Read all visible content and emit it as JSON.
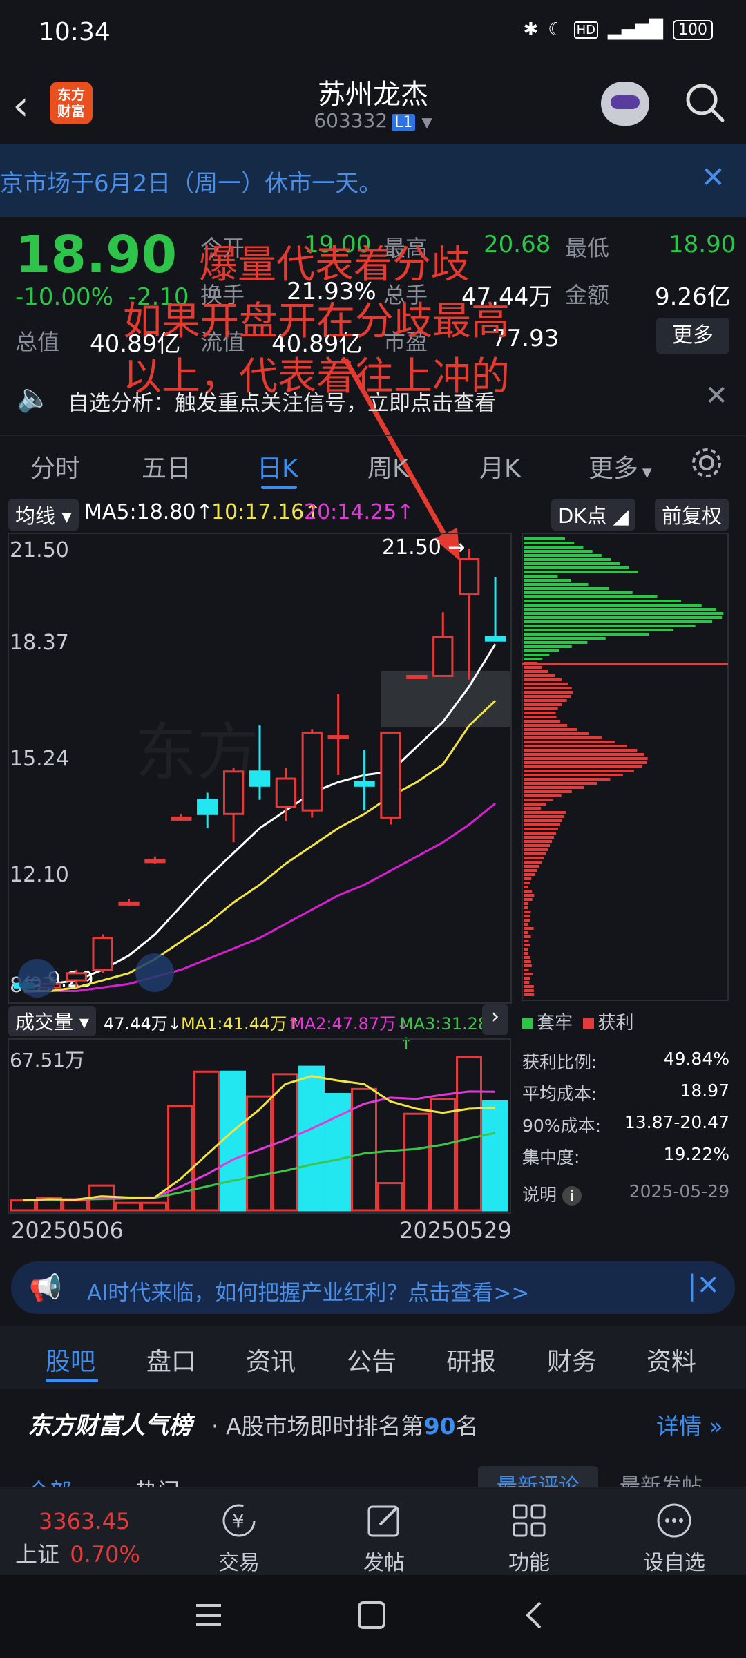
{
  "status": {
    "time": "10:34",
    "icons": [
      "bluetooth-icon",
      "moon-icon",
      "hd-icon",
      "signal-4g-icon"
    ],
    "battery": "100"
  },
  "header": {
    "logo_line1": "东方",
    "logo_line2": "财富",
    "name": "苏州龙杰",
    "code": "603332",
    "level": "L1"
  },
  "notice": {
    "text": "京市场于6月2日（周一）休市一天。"
  },
  "quote": {
    "price": "18.90",
    "change_pct": "-10.00%",
    "change_abs": "-2.10",
    "open_label": "今开",
    "open": "19.00",
    "high_label": "最高",
    "high": "20.68",
    "low_label": "最低",
    "low": "18.90",
    "turnover_label": "换手",
    "turnover": "21.93%",
    "volume_label": "总手",
    "volume": "47.44万",
    "amount_label": "金额",
    "amount": "9.26亿",
    "mktcap_label": "总值",
    "mktcap": "40.89亿",
    "float_label": "流值",
    "float": "40.89亿",
    "pe_label": "市盈",
    "pe": "77.93",
    "more_label": "更多"
  },
  "alert": {
    "text": "自选分析：触发重点关注信号，立即点击查看"
  },
  "tabs": [
    "分时",
    "五日",
    "日K",
    "周K",
    "月K",
    "更多"
  ],
  "ma_bar": {
    "type_label": "均线",
    "ma5": "MA5:18.80",
    "ma10": "10:17.16",
    "ma20": "20:14.25",
    "dk_label": "DK点",
    "adjust_label": "前复权"
  },
  "annotation": {
    "line1": "爆量代表着分歧",
    "line2": "如果开盘开在分歧最高",
    "line3": "以上，代表着往上冲的"
  },
  "chart_data": [
    {
      "type": "candlestick",
      "title": "日K",
      "y_ticks": [
        "21.50",
        "18.37",
        "15.24",
        "12.10",
        "8.97"
      ],
      "ylim": [
        8.97,
        21.5
      ],
      "high_marker": "21.50",
      "low_marker": "9.29",
      "candles": [
        {
          "o": 9.2,
          "h": 9.3,
          "l": 9.0,
          "c": 9.1
        },
        {
          "o": 9.1,
          "h": 9.3,
          "l": 9.0,
          "c": 9.2
        },
        {
          "o": 9.3,
          "h": 9.6,
          "l": 9.1,
          "c": 9.5
        },
        {
          "o": 9.6,
          "h": 10.6,
          "l": 9.5,
          "c": 10.5
        },
        {
          "o": 11.5,
          "h": 11.6,
          "l": 11.4,
          "c": 11.5
        },
        {
          "o": 12.7,
          "h": 12.8,
          "l": 12.6,
          "c": 12.7
        },
        {
          "o": 13.9,
          "h": 14.0,
          "l": 13.8,
          "c": 13.9
        },
        {
          "o": 14.4,
          "h": 14.6,
          "l": 13.6,
          "c": 14.0
        },
        {
          "o": 14.0,
          "h": 15.3,
          "l": 13.2,
          "c": 15.2
        },
        {
          "o": 15.2,
          "h": 16.5,
          "l": 14.4,
          "c": 14.8
        },
        {
          "o": 14.2,
          "h": 15.3,
          "l": 13.8,
          "c": 15.0
        },
        {
          "o": 14.1,
          "h": 16.4,
          "l": 13.9,
          "c": 16.3
        },
        {
          "o": 16.2,
          "h": 17.4,
          "l": 15.1,
          "c": 16.2
        },
        {
          "o": 14.9,
          "h": 15.8,
          "l": 14.1,
          "c": 14.8
        },
        {
          "o": 13.9,
          "h": 16.3,
          "l": 13.7,
          "c": 16.3
        },
        {
          "o": 17.9,
          "h": 17.9,
          "l": 17.9,
          "c": 17.9
        },
        {
          "o": 17.9,
          "h": 19.7,
          "l": 17.9,
          "c": 19.0
        },
        {
          "o": 20.2,
          "h": 21.5,
          "l": 17.8,
          "c": 21.2
        },
        {
          "o": 19.0,
          "h": 20.7,
          "l": 18.9,
          "c": 18.9
        }
      ],
      "ma5": [
        9.1,
        9.2,
        9.3,
        9.6,
        10.0,
        10.6,
        11.4,
        12.2,
        12.9,
        13.6,
        14.1,
        14.6,
        14.9,
        15.1,
        15.2,
        15.9,
        16.6,
        17.6,
        18.8
      ],
      "ma10": [
        9.0,
        9.0,
        9.1,
        9.3,
        9.5,
        9.9,
        10.4,
        10.9,
        11.5,
        12.0,
        12.6,
        13.1,
        13.6,
        14.0,
        14.5,
        14.9,
        15.4,
        16.5,
        17.2
      ],
      "ma20": [
        8.97,
        9.0,
        9.0,
        9.1,
        9.2,
        9.4,
        9.6,
        9.9,
        10.2,
        10.5,
        10.9,
        11.3,
        11.7,
        12.0,
        12.4,
        12.8,
        13.2,
        13.7,
        14.3
      ]
    },
    {
      "type": "bar",
      "title": "成交量",
      "header_value": "47.44万",
      "ma1": "MA1:41.44万",
      "ma2": "MA2:47.87万",
      "ma3": "MA3:31.28万",
      "ymax_label": "67.51万",
      "ylim": [
        0,
        67.51
      ],
      "x_start": "20250506",
      "x_end": "20250529",
      "values": [
        4,
        5,
        4,
        10,
        3,
        3,
        42,
        56,
        56,
        46,
        55,
        58,
        47,
        49,
        11,
        39,
        45,
        62,
        44
      ],
      "down": [
        false,
        false,
        false,
        false,
        false,
        false,
        false,
        false,
        true,
        false,
        false,
        true,
        true,
        false,
        false,
        false,
        false,
        false,
        true
      ],
      "ma1_values": [
        4,
        4.5,
        4.3,
        5.7,
        5.2,
        5.0,
        12.6,
        22.4,
        32,
        40.6,
        51,
        54.2,
        52.4,
        51.0,
        44,
        41,
        39.4,
        41,
        41.4
      ],
      "ma2_values": [
        4,
        4.3,
        4.5,
        5.0,
        5.2,
        5.2,
        9.5,
        14.5,
        20.5,
        24.5,
        28.4,
        33.0,
        38.0,
        43.0,
        45.5,
        45.0,
        46.7,
        48.0,
        47.9
      ],
      "ma3_values": [
        4,
        4.2,
        4.3,
        4.6,
        4.8,
        5.0,
        7.2,
        9.6,
        12.0,
        14.0,
        16.0,
        18.5,
        20.5,
        23.0,
        24.0,
        24.8,
        26.5,
        29.0,
        31.3
      ]
    },
    {
      "type": "bar",
      "title": "筹码分布",
      "legend": [
        "套牢",
        "获利"
      ],
      "stats": [
        {
          "label": "获利比例:",
          "value": "49.84%"
        },
        {
          "label": "平均成本:",
          "value": "18.97"
        },
        {
          "label": "90%成本:",
          "value": "13.87-20.47"
        },
        {
          "label": "集中度:",
          "value": "19.22%"
        }
      ],
      "explain_label": "说明",
      "date": "2025-05-29"
    }
  ],
  "ad": {
    "text": "AI时代来临，如何把握产业红利？点击查看>>"
  },
  "bottom_tabs": [
    "股吧",
    "盘口",
    "资讯",
    "公告",
    "研报",
    "财务",
    "资料"
  ],
  "popularity": {
    "brand": "东方财富人气榜",
    "text": "· A股市场即时排名第",
    "rank": "90",
    "suffix": "名",
    "detail": "详情"
  },
  "feed": {
    "tab1": "全部",
    "tab2": "热门",
    "sort1": "最新评论",
    "sort2": "最新发帖"
  },
  "index": {
    "value": "3363.45",
    "name": "上证",
    "change": "0.70%"
  },
  "nav": [
    "交易",
    "发帖",
    "功能",
    "设自选"
  ]
}
